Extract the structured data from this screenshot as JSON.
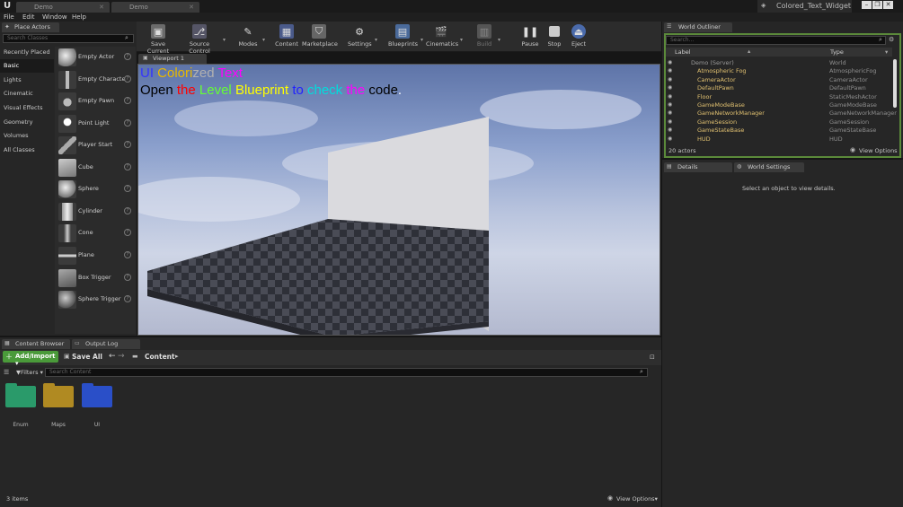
{
  "window": {
    "tabs": [
      "Demo",
      "Demo"
    ],
    "project_name": "Colored_Text_Widget",
    "controls": [
      "–",
      "❐",
      "✕"
    ]
  },
  "menubar": [
    "File",
    "Edit",
    "Window",
    "Help"
  ],
  "toolbar": [
    {
      "label": "Save Current",
      "icon": "save-icon"
    },
    {
      "label": "Source Control",
      "icon": "source-control-icon"
    },
    {
      "label": "Modes",
      "icon": "modes-icon"
    },
    {
      "label": "Content",
      "icon": "content-icon"
    },
    {
      "label": "Marketplace",
      "icon": "marketplace-icon"
    },
    {
      "label": "Settings",
      "icon": "settings-icon"
    },
    {
      "label": "Blueprints",
      "icon": "blueprints-icon"
    },
    {
      "label": "Cinematics",
      "icon": "cinematics-icon"
    },
    {
      "label": "Build",
      "icon": "build-icon"
    },
    {
      "label": "Pause",
      "icon": "pause-icon"
    },
    {
      "label": "Stop",
      "icon": "stop-icon"
    },
    {
      "label": "Eject",
      "icon": "eject-icon"
    }
  ],
  "place_actors": {
    "tab_label": "Place Actors",
    "search_placeholder": "Search Classes",
    "categories": [
      "Recently Placed",
      "Basic",
      "Lights",
      "Cinematic",
      "Visual Effects",
      "Geometry",
      "Volumes",
      "All Classes"
    ],
    "selected_category": "Basic",
    "actors": [
      "Empty Actor",
      "Empty Characte",
      "Empty Pawn",
      "Point Light",
      "Player Start",
      "Cube",
      "Sphere",
      "Cylinder",
      "Cone",
      "Plane",
      "Box Trigger",
      "Sphere Trigger"
    ]
  },
  "viewport": {
    "tab_label": "Viewport 1",
    "line1": [
      {
        "text": "UI ",
        "color": "#3333ff"
      },
      {
        "text": "Colori",
        "color": "#e8b800"
      },
      {
        "text": "zed ",
        "color": "#b0b0b0"
      },
      {
        "text": "Text",
        "color": "#ff00ff"
      }
    ],
    "line2": [
      {
        "text": "Open ",
        "color": "#000000"
      },
      {
        "text": "the ",
        "color": "#ff0000"
      },
      {
        "text": "Level ",
        "color": "#66ff33"
      },
      {
        "text": "Blueprint ",
        "color": "#ffff00"
      },
      {
        "text": "to ",
        "color": "#2222ff"
      },
      {
        "text": "check ",
        "color": "#00dddd"
      },
      {
        "text": "the ",
        "color": "#ff00ff"
      },
      {
        "text": "code",
        "color": "#000000"
      },
      {
        "text": ".",
        "color": "#ffffff"
      }
    ]
  },
  "outliner": {
    "tab_label": "World Outliner",
    "search_placeholder": "Search...",
    "col_label": "Label",
    "col_type": "Type",
    "rows": [
      {
        "label": "Demo (Server)",
        "type": "World"
      },
      {
        "label": "Atmospheric Fog",
        "type": "AtmosphericFog"
      },
      {
        "label": "CameraActor",
        "type": "CameraActor"
      },
      {
        "label": "DefaultPawn",
        "type": "DefaultPawn"
      },
      {
        "label": "Floor",
        "type": "StaticMeshActor"
      },
      {
        "label": "GameModeBase",
        "type": "GameModeBase"
      },
      {
        "label": "GameNetworkManager",
        "type": "GameNetworkManager"
      },
      {
        "label": "GameSession",
        "type": "GameSession"
      },
      {
        "label": "GameStateBase",
        "type": "GameStateBase"
      },
      {
        "label": "HUD",
        "type": "HUD"
      }
    ],
    "count": "20 actors",
    "view_options": "View Options"
  },
  "details": {
    "tab_details": "Details",
    "tab_world_settings": "World Settings",
    "message": "Select an object to view details."
  },
  "content_browser": {
    "tab_label": "Content Browser",
    "tab_output": "Output Log",
    "add_import": "Add/Import",
    "save_all": "Save All",
    "path": "Content",
    "filters": "Filters",
    "search_placeholder": "Search Content",
    "folders": [
      {
        "name": "Enum",
        "color": "#2a9a6a"
      },
      {
        "name": "Maps",
        "color": "#b08a22"
      },
      {
        "name": "UI",
        "color": "#2a4fc8"
      }
    ],
    "items_count": "3 items",
    "view_options": "View Options"
  }
}
